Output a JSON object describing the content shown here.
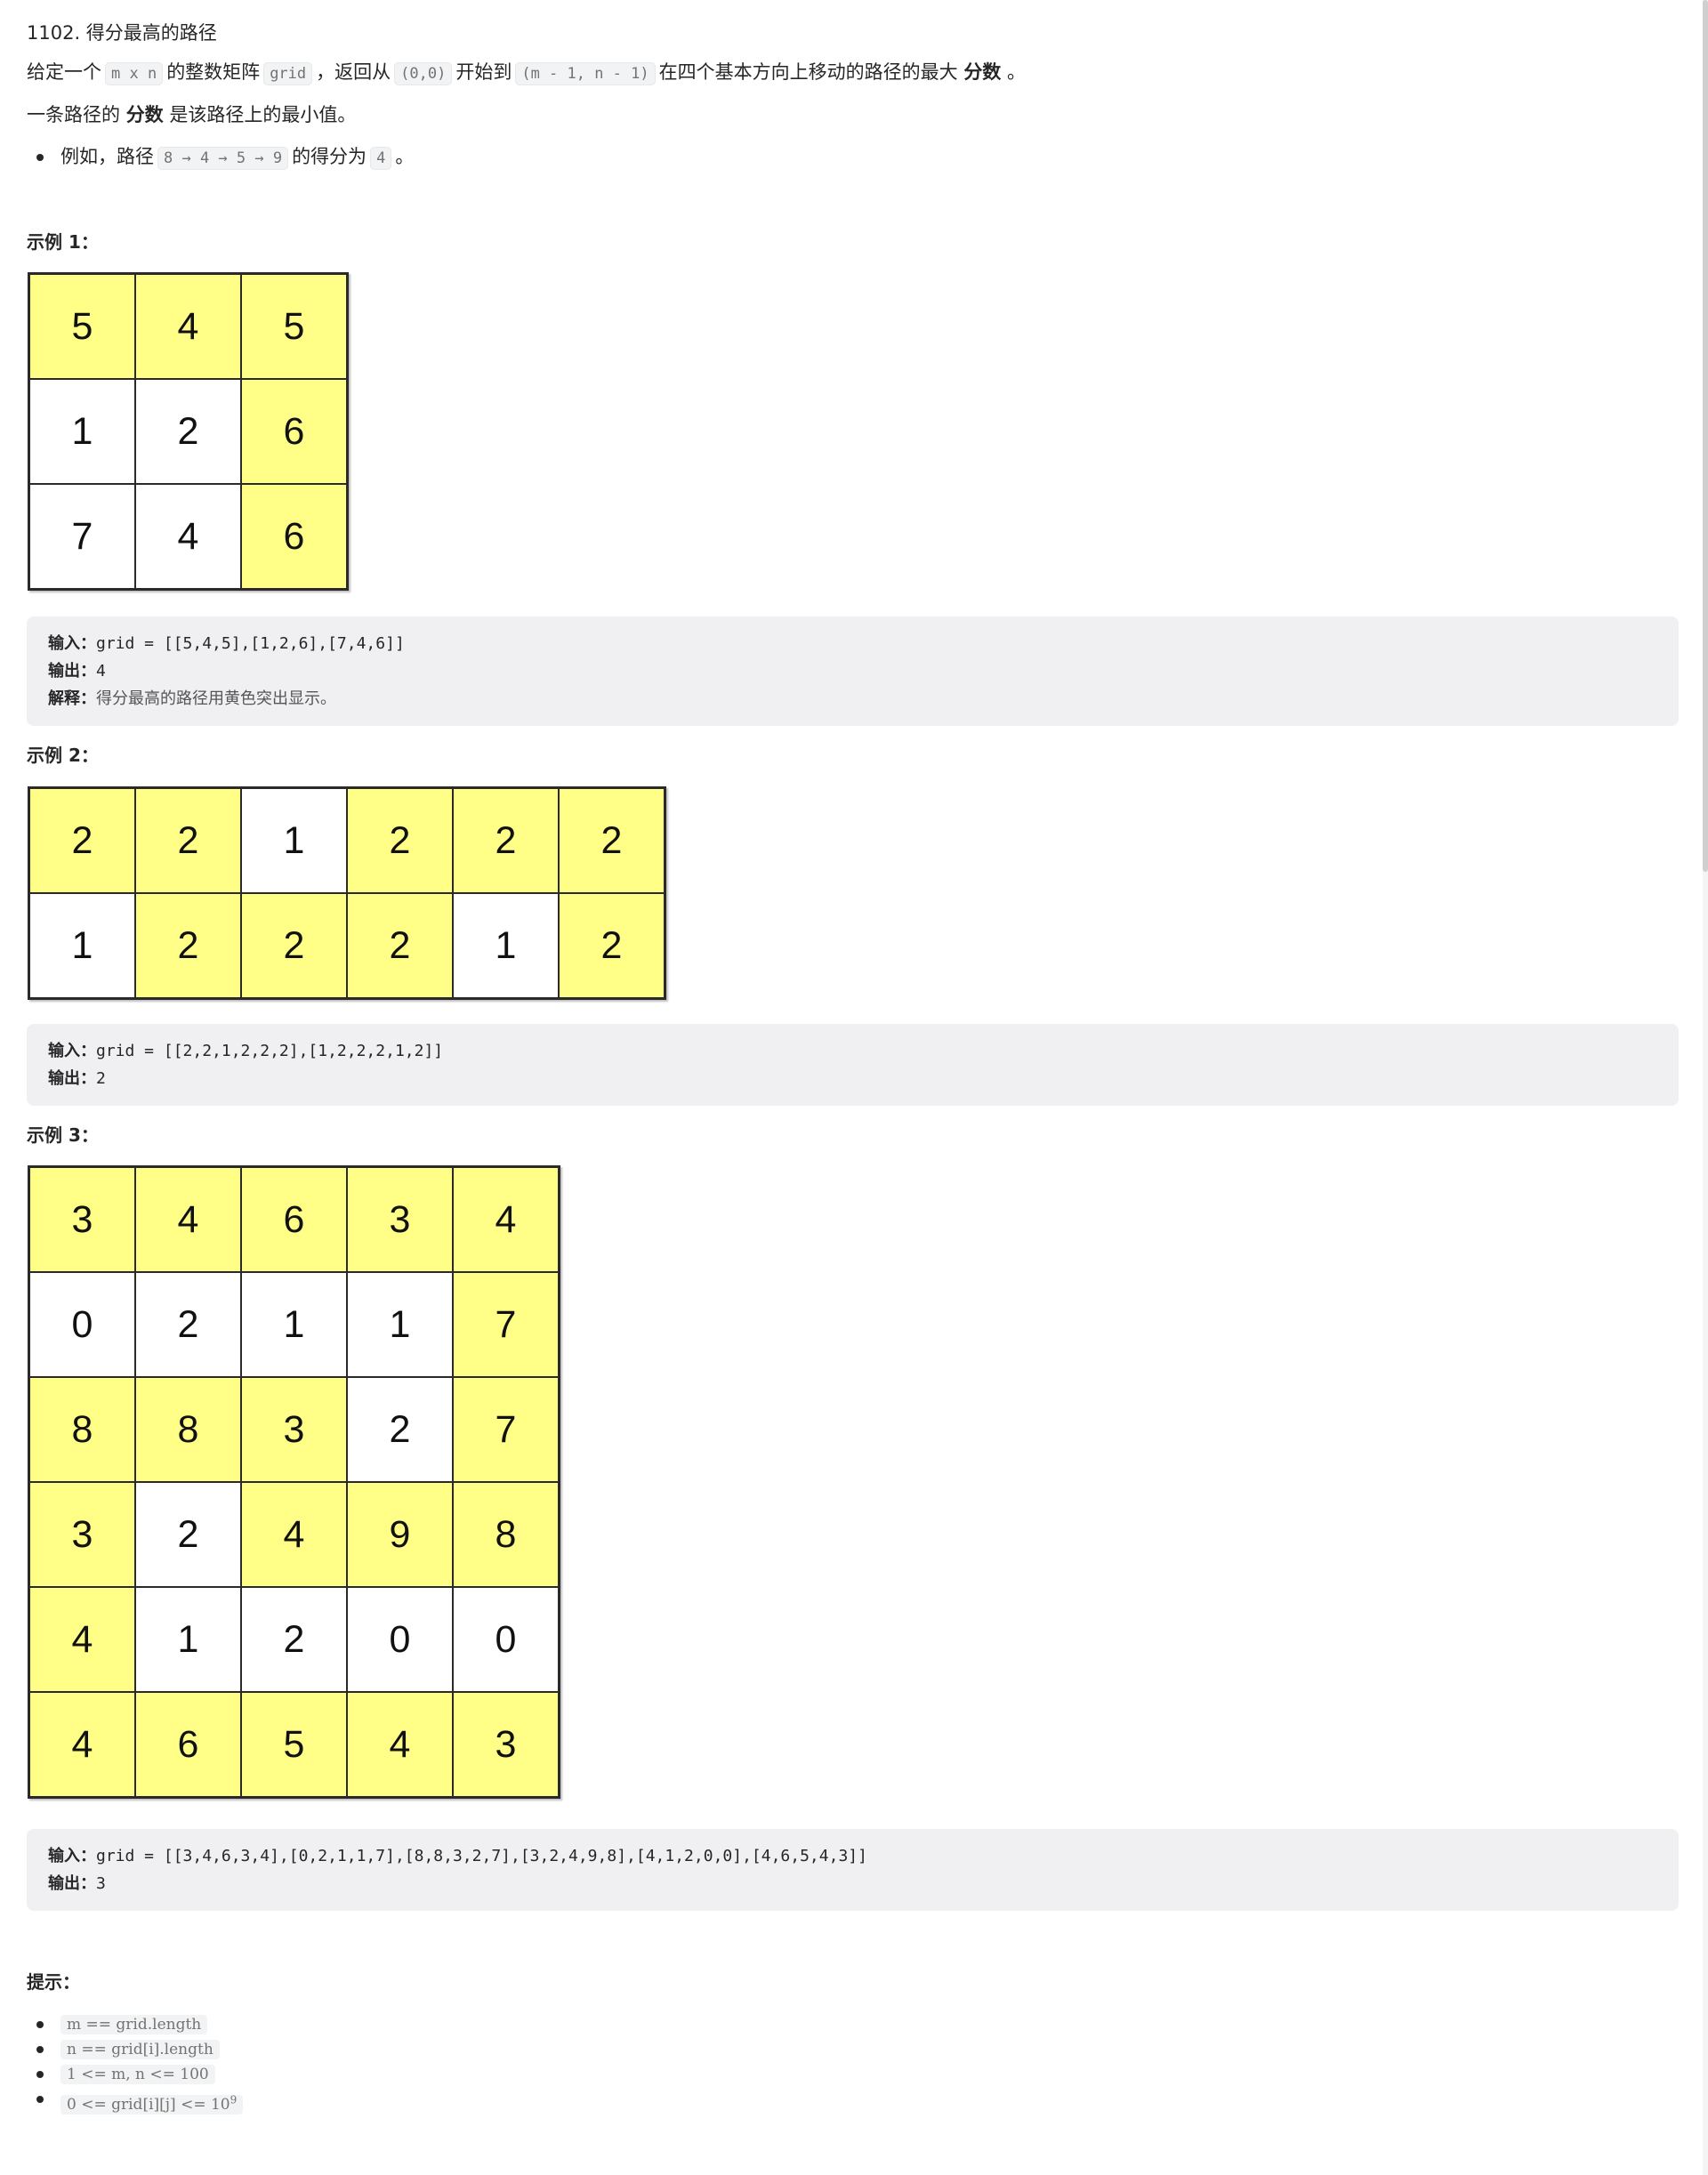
{
  "problem": {
    "title": "1102. 得分最高的路径",
    "desc": {
      "t1": "给定一个",
      "c1": "m x n",
      "t2": "的整数矩阵",
      "c2": "grid",
      "t3": "，返回从",
      "c3": "(0,0)",
      "t4": "开始到",
      "c4": "(m - 1, n - 1)",
      "t5": "在四个基本方向上移动的路径的最大",
      "b1": "分数",
      "t6": "。"
    },
    "score_def": {
      "t1": "一条路径的",
      "b1": "分数",
      "t2": "是该路径上的最小值。"
    },
    "bullet": {
      "t1": "例如，路径",
      "c1": "8 → 4 → 5 → 9",
      "t2": "的得分为",
      "c2": "4",
      "t3": "。"
    }
  },
  "labels": {
    "input": "输入：",
    "output": "输出：",
    "explain": "解释："
  },
  "examples": [
    {
      "title": "示例 1：",
      "grid": [
        [
          5,
          4,
          5
        ],
        [
          1,
          2,
          6
        ],
        [
          7,
          4,
          6
        ]
      ],
      "path": [
        [
          1,
          1,
          1
        ],
        [
          0,
          0,
          1
        ],
        [
          0,
          0,
          1
        ]
      ],
      "input": "grid = [[5,4,5],[1,2,6],[7,4,6]]",
      "output": "4",
      "explanation": "得分最高的路径用黄色突出显示。"
    },
    {
      "title": "示例 2：",
      "grid": [
        [
          2,
          2,
          1,
          2,
          2,
          2
        ],
        [
          1,
          2,
          2,
          2,
          1,
          2
        ]
      ],
      "path": [
        [
          1,
          1,
          0,
          1,
          1,
          1
        ],
        [
          0,
          1,
          1,
          1,
          0,
          1
        ]
      ],
      "input": "grid = [[2,2,1,2,2,2],[1,2,2,2,1,2]]",
      "output": "2"
    },
    {
      "title": "示例 3：",
      "grid": [
        [
          3,
          4,
          6,
          3,
          4
        ],
        [
          0,
          2,
          1,
          1,
          7
        ],
        [
          8,
          8,
          3,
          2,
          7
        ],
        [
          3,
          2,
          4,
          9,
          8
        ],
        [
          4,
          1,
          2,
          0,
          0
        ],
        [
          4,
          6,
          5,
          4,
          3
        ]
      ],
      "path": [
        [
          1,
          1,
          1,
          1,
          1
        ],
        [
          0,
          0,
          0,
          0,
          1
        ],
        [
          1,
          1,
          1,
          0,
          1
        ],
        [
          1,
          0,
          1,
          1,
          1
        ],
        [
          1,
          0,
          0,
          0,
          0
        ],
        [
          1,
          1,
          1,
          1,
          1
        ]
      ],
      "input": "grid = [[3,4,6,3,4],[0,2,1,1,7],[8,8,3,2,7],[3,2,4,9,8],[4,1,2,0,0],[4,6,5,4,3]]",
      "output": "3"
    }
  ],
  "hints": {
    "title": "提示：",
    "items": [
      "m == grid.length",
      "n == grid[i].length",
      "1 <= m, n <= 100",
      "0 <= grid[i][j] <= 10"
    ],
    "last_sup": "9"
  },
  "colors": {
    "highlight": "#ffff88",
    "cell": "#ffffff",
    "border": "#2a2a2a"
  }
}
